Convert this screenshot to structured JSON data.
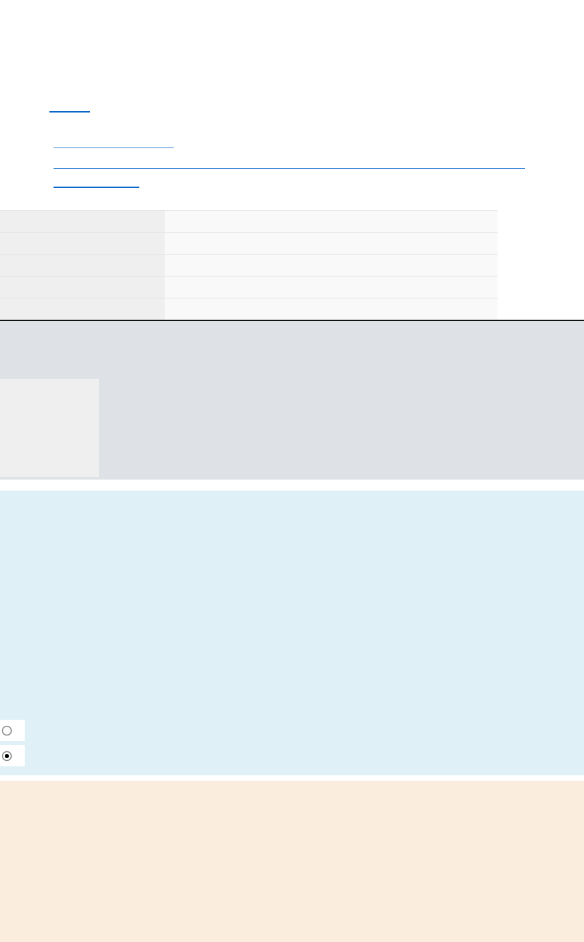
{
  "radios": [
    {
      "selected": false
    },
    {
      "selected": true
    }
  ]
}
